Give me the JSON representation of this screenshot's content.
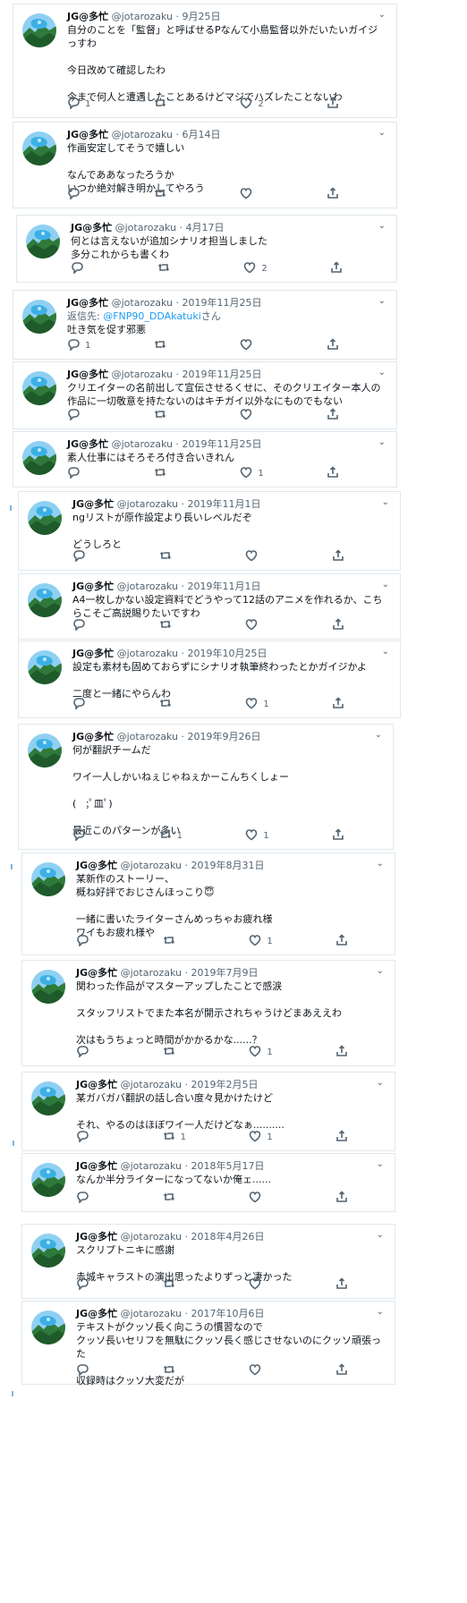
{
  "user": {
    "name": "JG@多忙",
    "handle": "@jotarozaku"
  },
  "menu_glyph": "⌄",
  "tweets": [
    {
      "date": "9月25日",
      "lines": [
        "自分のことを「監督」と呼ばせるPなんて小島監督以外だいたいガイジっすわ",
        "",
        "今日改めて確認したわ",
        "",
        "今まで何人と遭遇したことあるけどマジでハズレたことないわ"
      ],
      "replies": "1",
      "retweets": "",
      "likes": "2"
    },
    {
      "date": "6月14日",
      "lines": [
        "作画安定してそうで嬉しい",
        "",
        "なんでああなったろうか",
        "いつか絶対解き明かしてやろう"
      ],
      "replies": "",
      "retweets": "",
      "likes": ""
    },
    {
      "date": "4月17日",
      "lines": [
        "何とは言えないが追加シナリオ担当しました",
        "多分これからも書くわ"
      ],
      "replies": "",
      "retweets": "",
      "likes": "2"
    },
    {
      "date": "2019年11月25日",
      "reply_prefix": "返信先: ",
      "reply_mention": "@FNP90_DDAkatuki",
      "reply_suffix": "さん",
      "lines": [
        "吐き気を促す邪悪"
      ],
      "replies": "1",
      "retweets": "",
      "likes": ""
    },
    {
      "date": "2019年11月25日",
      "lines": [
        "クリエイターの名前出して宣伝させるくせに、そのクリエイター本人の作品に一切敬意を持たないのはキチガイ以外なにものでもない"
      ],
      "replies": "",
      "retweets": "",
      "likes": ""
    },
    {
      "date": "2019年11月25日",
      "lines": [
        "素人仕事にはそろそろ付き合いきれん"
      ],
      "replies": "",
      "retweets": "",
      "likes": "1"
    },
    {
      "date": "2019年11月1日",
      "lines": [
        "ngリストが原作設定より長いレベルだぞ",
        "",
        "どうしろと"
      ],
      "replies": "",
      "retweets": "",
      "likes": ""
    },
    {
      "date": "2019年11月1日",
      "lines": [
        "A4一枚しかない設定資料でどうやって12話のアニメを作れるか、こちらこそご高説賜りたいですわ"
      ],
      "replies": "",
      "retweets": "",
      "likes": ""
    },
    {
      "date": "2019年10月25日",
      "lines": [
        "設定も素材も固めておらずにシナリオ執筆終わったとかガイジかよ",
        "",
        "二度と一緒にやらんわ"
      ],
      "replies": "",
      "retweets": "",
      "likes": "1"
    },
    {
      "date": "2019年9月26日",
      "lines": [
        "何が翻訳チームだ",
        "",
        "ワイ一人しかいねぇじゃねぇかーこんちくしょー",
        "",
        "(　;ﾟ皿ﾟ)",
        "",
        "最近このパターンが多い"
      ],
      "replies": "",
      "retweets": "1",
      "likes": "1"
    },
    {
      "date": "2019年8月31日",
      "lines": [
        "某新作のストーリー、",
        "概ね好評でおじさんほっこり😇",
        "",
        "一緒に書いたライターさんめっちゃお疲れ様",
        "ワイもお疲れ様や"
      ],
      "replies": "",
      "retweets": "",
      "likes": "1"
    },
    {
      "date": "2019年7月9日",
      "lines": [
        "関わった作品がマスターアップしたことで感涙",
        "",
        "スタッフリストでまた本名が開示されちゃうけどまあええわ",
        "",
        "次はもうちょっと時間がかかるかな......？"
      ],
      "replies": "",
      "retweets": "",
      "likes": "1"
    },
    {
      "date": "2019年2月5日",
      "lines": [
        "某ガバガバ翻訳の話し合い度々見かけたけど",
        "",
        "それ、やるのはほぼワイ一人だけどなぁ.........."
      ],
      "replies": "",
      "retweets": "1",
      "likes": "1"
    },
    {
      "date": "2018年5月17日",
      "lines": [
        "なんか半分ライターになってないか俺ェ......"
      ],
      "replies": "",
      "retweets": "",
      "likes": ""
    },
    {
      "date": "2018年4月26日",
      "lines": [
        "スクリプトニキに感謝",
        "",
        "赤城キャラストの演出思ったよりずっと凄かった"
      ],
      "replies": "",
      "retweets": "",
      "likes": ""
    },
    {
      "date": "2017年10月6日",
      "lines": [
        "テキストがクッソ長く向こうの慣習なので",
        "クッソ長いセリフを無駄にクッソ長く感じさせないのにクッソ頑張った",
        "",
        "収録時はクッソ大変だが"
      ],
      "replies": "",
      "retweets": "",
      "likes": ""
    }
  ]
}
